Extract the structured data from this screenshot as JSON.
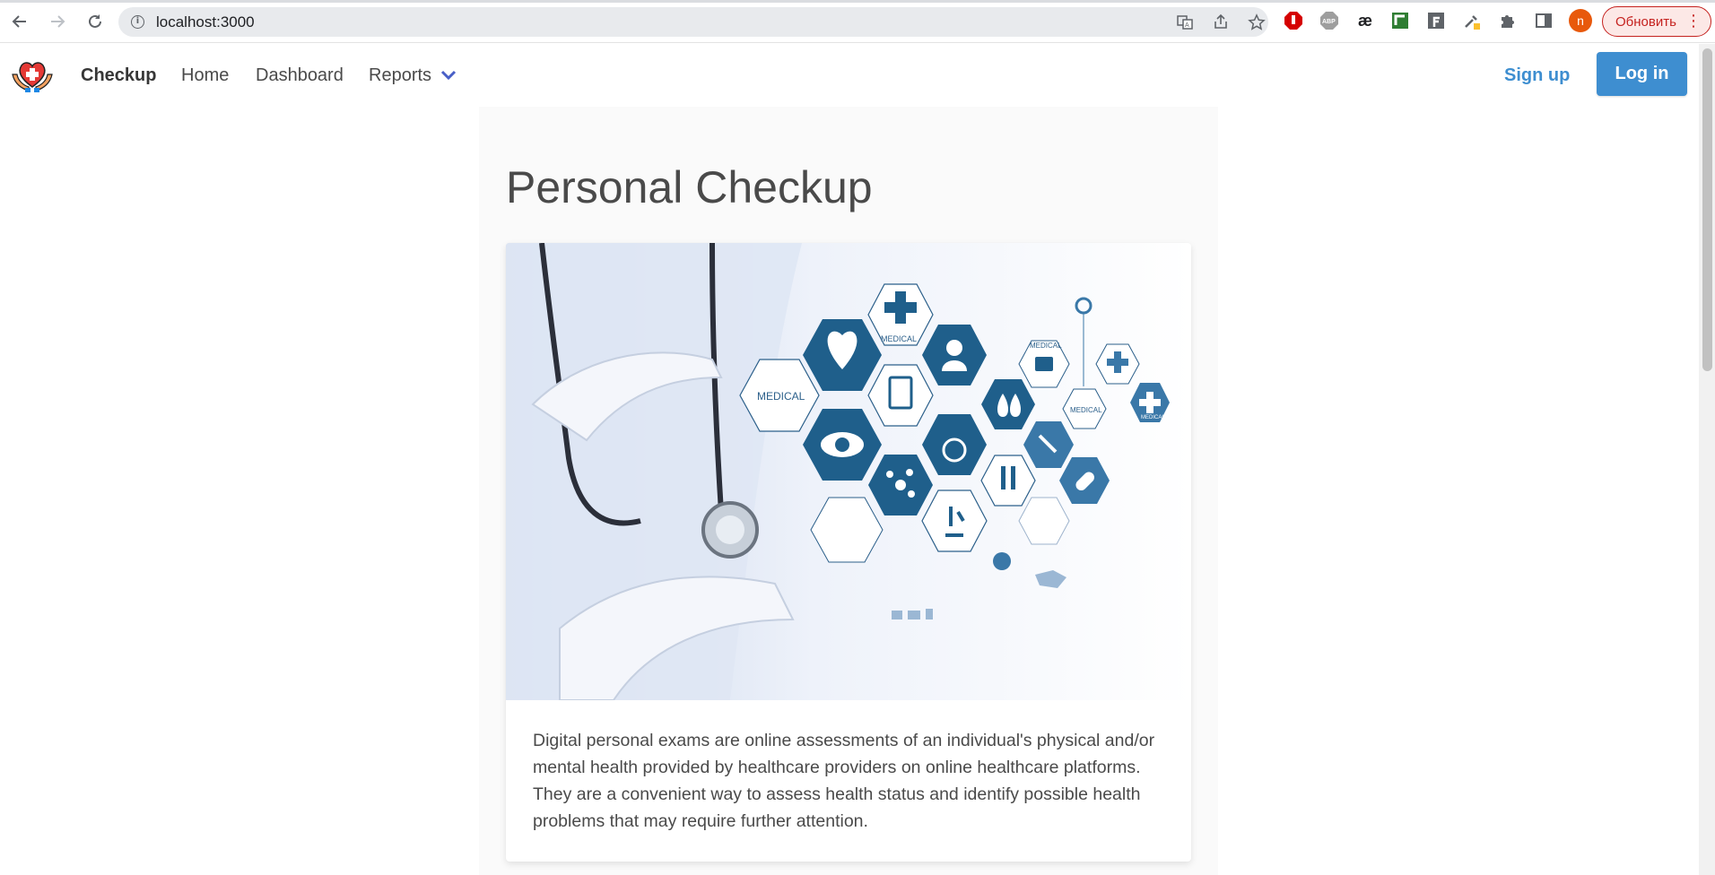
{
  "browser": {
    "url": "localhost:3000",
    "update_label": "Обновить",
    "profile_initial": "n",
    "icons": [
      "back-arrow-icon",
      "forward-arrow-icon",
      "reload-icon",
      "site-info-icon",
      "translate-icon",
      "share-icon",
      "bookmark-star-icon",
      "adblock-stop-icon",
      "abp-icon",
      "ae-icon",
      "green-extension-icon",
      "f-extension-icon",
      "eyedropper-icon",
      "extensions-puzzle-icon",
      "side-panel-icon",
      "profile-avatar",
      "menu-dots-icon"
    ],
    "colors": {
      "update_border": "#c5221f",
      "profile_bg": "#e8590c"
    }
  },
  "navbar": {
    "brand": "Checkup",
    "links": [
      "Home",
      "Dashboard",
      "Reports"
    ],
    "signup": "Sign up",
    "login": "Log in",
    "colors": {
      "primary": "#3e8ed0",
      "text": "#4a4a4a"
    }
  },
  "main": {
    "title": "Personal Checkup",
    "hero_labels": [
      "MEDICAL",
      "MEDICAL",
      "MEDICAL",
      "MEDICAL",
      "MEDICAL"
    ],
    "description": "Digital personal exams are online assessments of an individual's physical and/or mental health provided by healthcare providers on online healthcare platforms. They are a convenient way to assess health status and identify possible health problems that may require further attention."
  }
}
